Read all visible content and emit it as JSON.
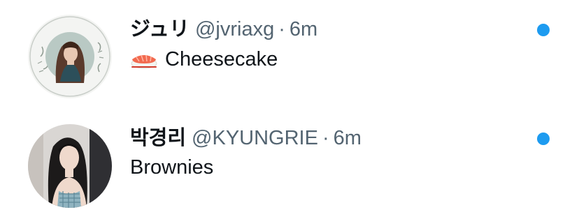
{
  "conversations": [
    {
      "display_name": "ジュリ",
      "handle": "@jvriaxg",
      "separator": "·",
      "time": "6m",
      "preview_icon": "sushi-icon",
      "preview": "Cheesecake",
      "unread": true
    },
    {
      "display_name": "박경리",
      "handle": "@KYUNGRIE",
      "separator": "·",
      "time": "6m",
      "preview": "Brownies",
      "unread": true
    }
  ],
  "colors": {
    "unread_dot": "#1d9bf0",
    "secondary_text": "#536471",
    "primary_text": "#0f1419"
  }
}
